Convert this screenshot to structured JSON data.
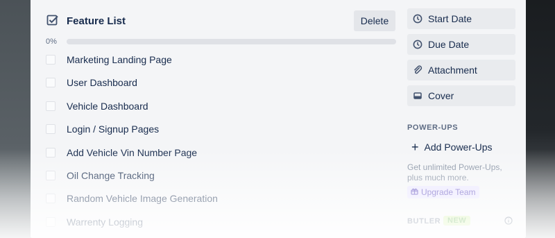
{
  "checklist": {
    "title": "Feature List",
    "delete_label": "Delete",
    "progress_label": "0%",
    "progress_fraction": 0,
    "items": [
      {
        "label": "Marketing Landing Page",
        "checked": false
      },
      {
        "label": "User Dashboard",
        "checked": false
      },
      {
        "label": "Vehicle Dashboard",
        "checked": false
      },
      {
        "label": "Login / Signup Pages",
        "checked": false
      },
      {
        "label": "Add Vehicle Vin Number Page",
        "checked": false
      },
      {
        "label": "Oil Change Tracking",
        "checked": false
      },
      {
        "label": "Random Vehicle Image Generation",
        "checked": false
      },
      {
        "label": "Warrenty Logging",
        "checked": false
      }
    ]
  },
  "sidebar": {
    "buttons": [
      {
        "label": "Start Date",
        "icon": "clock-icon"
      },
      {
        "label": "Due Date",
        "icon": "clock-icon"
      },
      {
        "label": "Attachment",
        "icon": "paperclip-icon"
      },
      {
        "label": "Cover",
        "icon": "cover-icon"
      }
    ],
    "powerups_heading": "POWER-UPS",
    "add_powerups_label": "Add Power-Ups",
    "promo_text": "Get unlimited Power-Ups, plus much more.",
    "upgrade_label": "Upgrade Team",
    "butler_heading": "BUTLER",
    "new_badge": "NEW"
  },
  "colors": {
    "accent": "#5aac44",
    "text": "#172b4d",
    "muted": "#5e6c84",
    "upgrade": "#6554c0"
  }
}
